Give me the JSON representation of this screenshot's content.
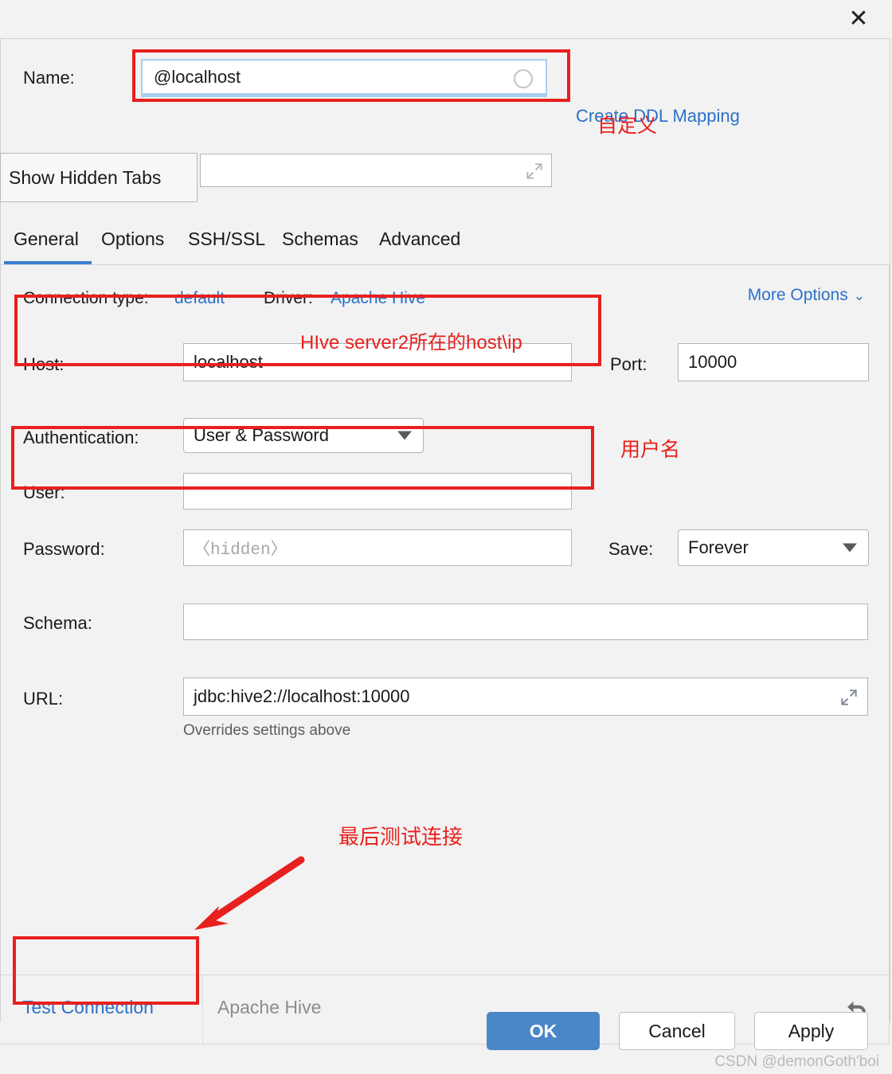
{
  "titlebar": {
    "close_label": "✕"
  },
  "name_row": {
    "label": "Name:",
    "value": "@localhost",
    "placeholder": "",
    "ddl_link": "Create DDL Mapping"
  },
  "comment_row": {
    "value": "",
    "placeholder": ""
  },
  "tooltip": {
    "label": "Show Hidden Tabs"
  },
  "tabs": {
    "items": [
      {
        "label": "General",
        "active": true
      },
      {
        "label": "Options",
        "active": false
      },
      {
        "label": "SSH/SSL",
        "active": false
      },
      {
        "label": "Schemas",
        "active": false
      },
      {
        "label": "Advanced",
        "active": false
      }
    ]
  },
  "meta": {
    "connection_type_label": "Connection type:",
    "connection_type_value": "default",
    "driver_label": "Driver:",
    "driver_value": "Apache Hive",
    "more_options": "More Options",
    "chevron": "⌄"
  },
  "fields": {
    "host_label": "Host:",
    "host_value": "localhost",
    "port_label": "Port:",
    "port_value": "10000",
    "auth_label": "Authentication:",
    "auth_value": "User & Password",
    "user_label": "User:",
    "user_value": "",
    "password_label": "Password:",
    "password_placeholder": "〈hidden〉",
    "save_label": "Save:",
    "save_value": "Forever",
    "schema_label": "Schema:",
    "schema_value": "",
    "url_label": "URL:",
    "url_value": "jdbc:hive2://localhost:10000",
    "url_hint": "Overrides settings above"
  },
  "footer": {
    "test_connection": "Test Connection",
    "driver_name": "Apache Hive",
    "revert_icon": "revert-icon"
  },
  "buttons": {
    "ok": "OK",
    "cancel": "Cancel",
    "apply": "Apply"
  },
  "annotations": {
    "custom_name": "自定义",
    "host_note": "HIve server2所在的host\\ip",
    "user_note": "用户名",
    "test_note": "最后测试连接"
  },
  "watermark": {
    "text": "CSDN @demonGoth'boi"
  },
  "colors": {
    "accent_blue": "#2b71c7",
    "ok_button": "#4a86c8",
    "annotation_red": "#e8201e",
    "panel_bg": "#f2f2f2"
  }
}
